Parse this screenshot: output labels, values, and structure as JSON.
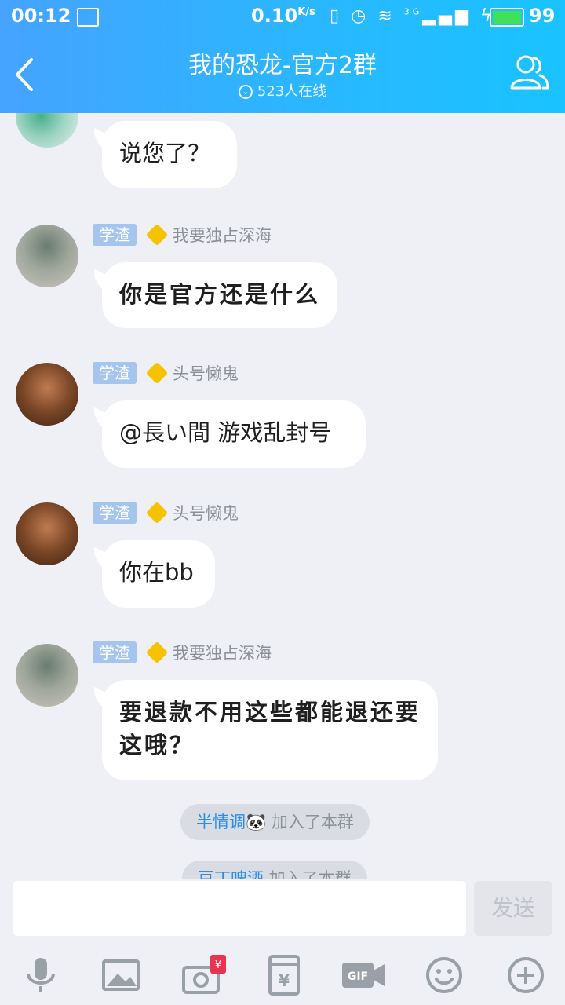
{
  "status_bar": {
    "time": "00:12",
    "net_speed": "0.10",
    "net_unit": "K/s",
    "net_type": "3G",
    "battery": "99"
  },
  "header": {
    "title": "我的恐龙-官方2群",
    "online": "523人在线",
    "back_icon": "chevron-left-icon",
    "members_icon": "people-icon"
  },
  "messages": [
    {
      "text": "说您了？"
    },
    {
      "badge": "学渣",
      "nick": "我要独占深海",
      "text": "你是官方还是什么"
    },
    {
      "badge": "学渣",
      "nick": "头号懒鬼",
      "text": "@長い間 游戏乱封号"
    },
    {
      "badge": "学渣",
      "nick": "头号懒鬼",
      "text": "你在bb"
    },
    {
      "badge": "学渣",
      "nick": "我要独占深海",
      "text_line1": "要退款不用这些都能退还要",
      "text_line2": "这哦？"
    }
  ],
  "system_notices": [
    {
      "who": "半情调🐼",
      "action": " 加入了本群"
    },
    {
      "who": "豆丁啤酒",
      "action": " 加入了本群"
    }
  ],
  "input": {
    "send_label": "发送",
    "placeholder": ""
  },
  "toolbar": [
    "mic-icon",
    "image-icon",
    "camera-icon",
    "red-packet-icon",
    "gif-icon",
    "emoji-icon",
    "plus-icon"
  ]
}
